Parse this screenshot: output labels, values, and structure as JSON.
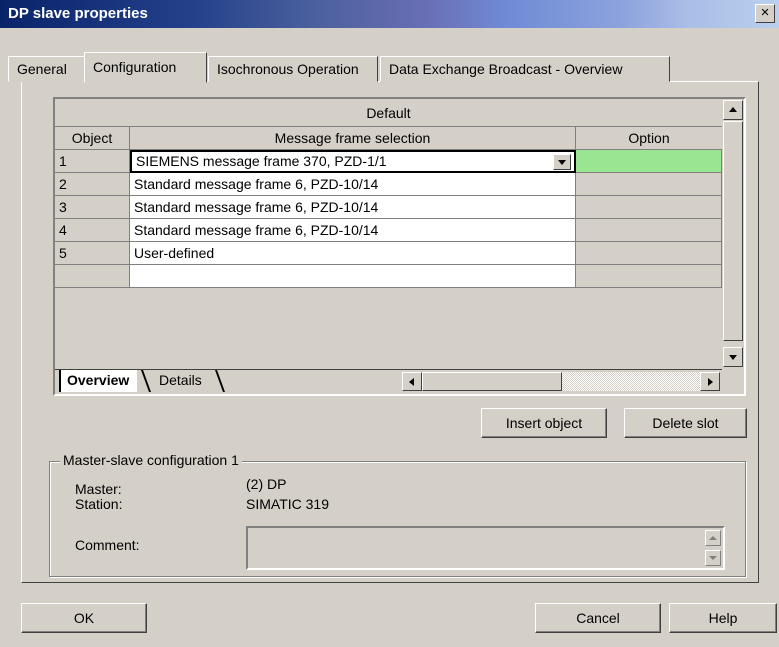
{
  "window": {
    "title": "DP slave properties",
    "close_glyph": "×"
  },
  "tabs": [
    {
      "label": "General",
      "active": false
    },
    {
      "label": "Configuration",
      "active": true
    },
    {
      "label": "Isochronous Operation",
      "active": false
    },
    {
      "label": "Data Exchange Broadcast - Overview",
      "active": false
    }
  ],
  "grid": {
    "group_header": "Default",
    "columns": [
      "Object",
      "Message frame selection",
      "Option"
    ],
    "rows": [
      {
        "object": "1",
        "message": "SIEMENS message frame 370, PZD-1/1",
        "option": "",
        "selected": true
      },
      {
        "object": "2",
        "message": "Standard message frame 6, PZD-10/14",
        "option": ""
      },
      {
        "object": "3",
        "message": "Standard message frame 6, PZD-10/14",
        "option": ""
      },
      {
        "object": "4",
        "message": "Standard message frame 6, PZD-10/14",
        "option": ""
      },
      {
        "object": "5",
        "message": "User-defined",
        "option": ""
      },
      {
        "object": "",
        "message": "",
        "option": ""
      }
    ],
    "sheet_tabs": [
      "Overview",
      "Details"
    ],
    "selected_color": "#9ae592"
  },
  "actions": {
    "insert_object": "Insert object",
    "delete_slot": "Delete slot"
  },
  "master_slave": {
    "legend": "Master-slave configuration 1",
    "master_label": "Master:",
    "master_value": "(2) DP",
    "station_label": "Station:",
    "station_value": "SIMATIC 319",
    "comment_label": "Comment:",
    "comment_value": ""
  },
  "footer": {
    "ok": "OK",
    "cancel": "Cancel",
    "help": "Help"
  }
}
